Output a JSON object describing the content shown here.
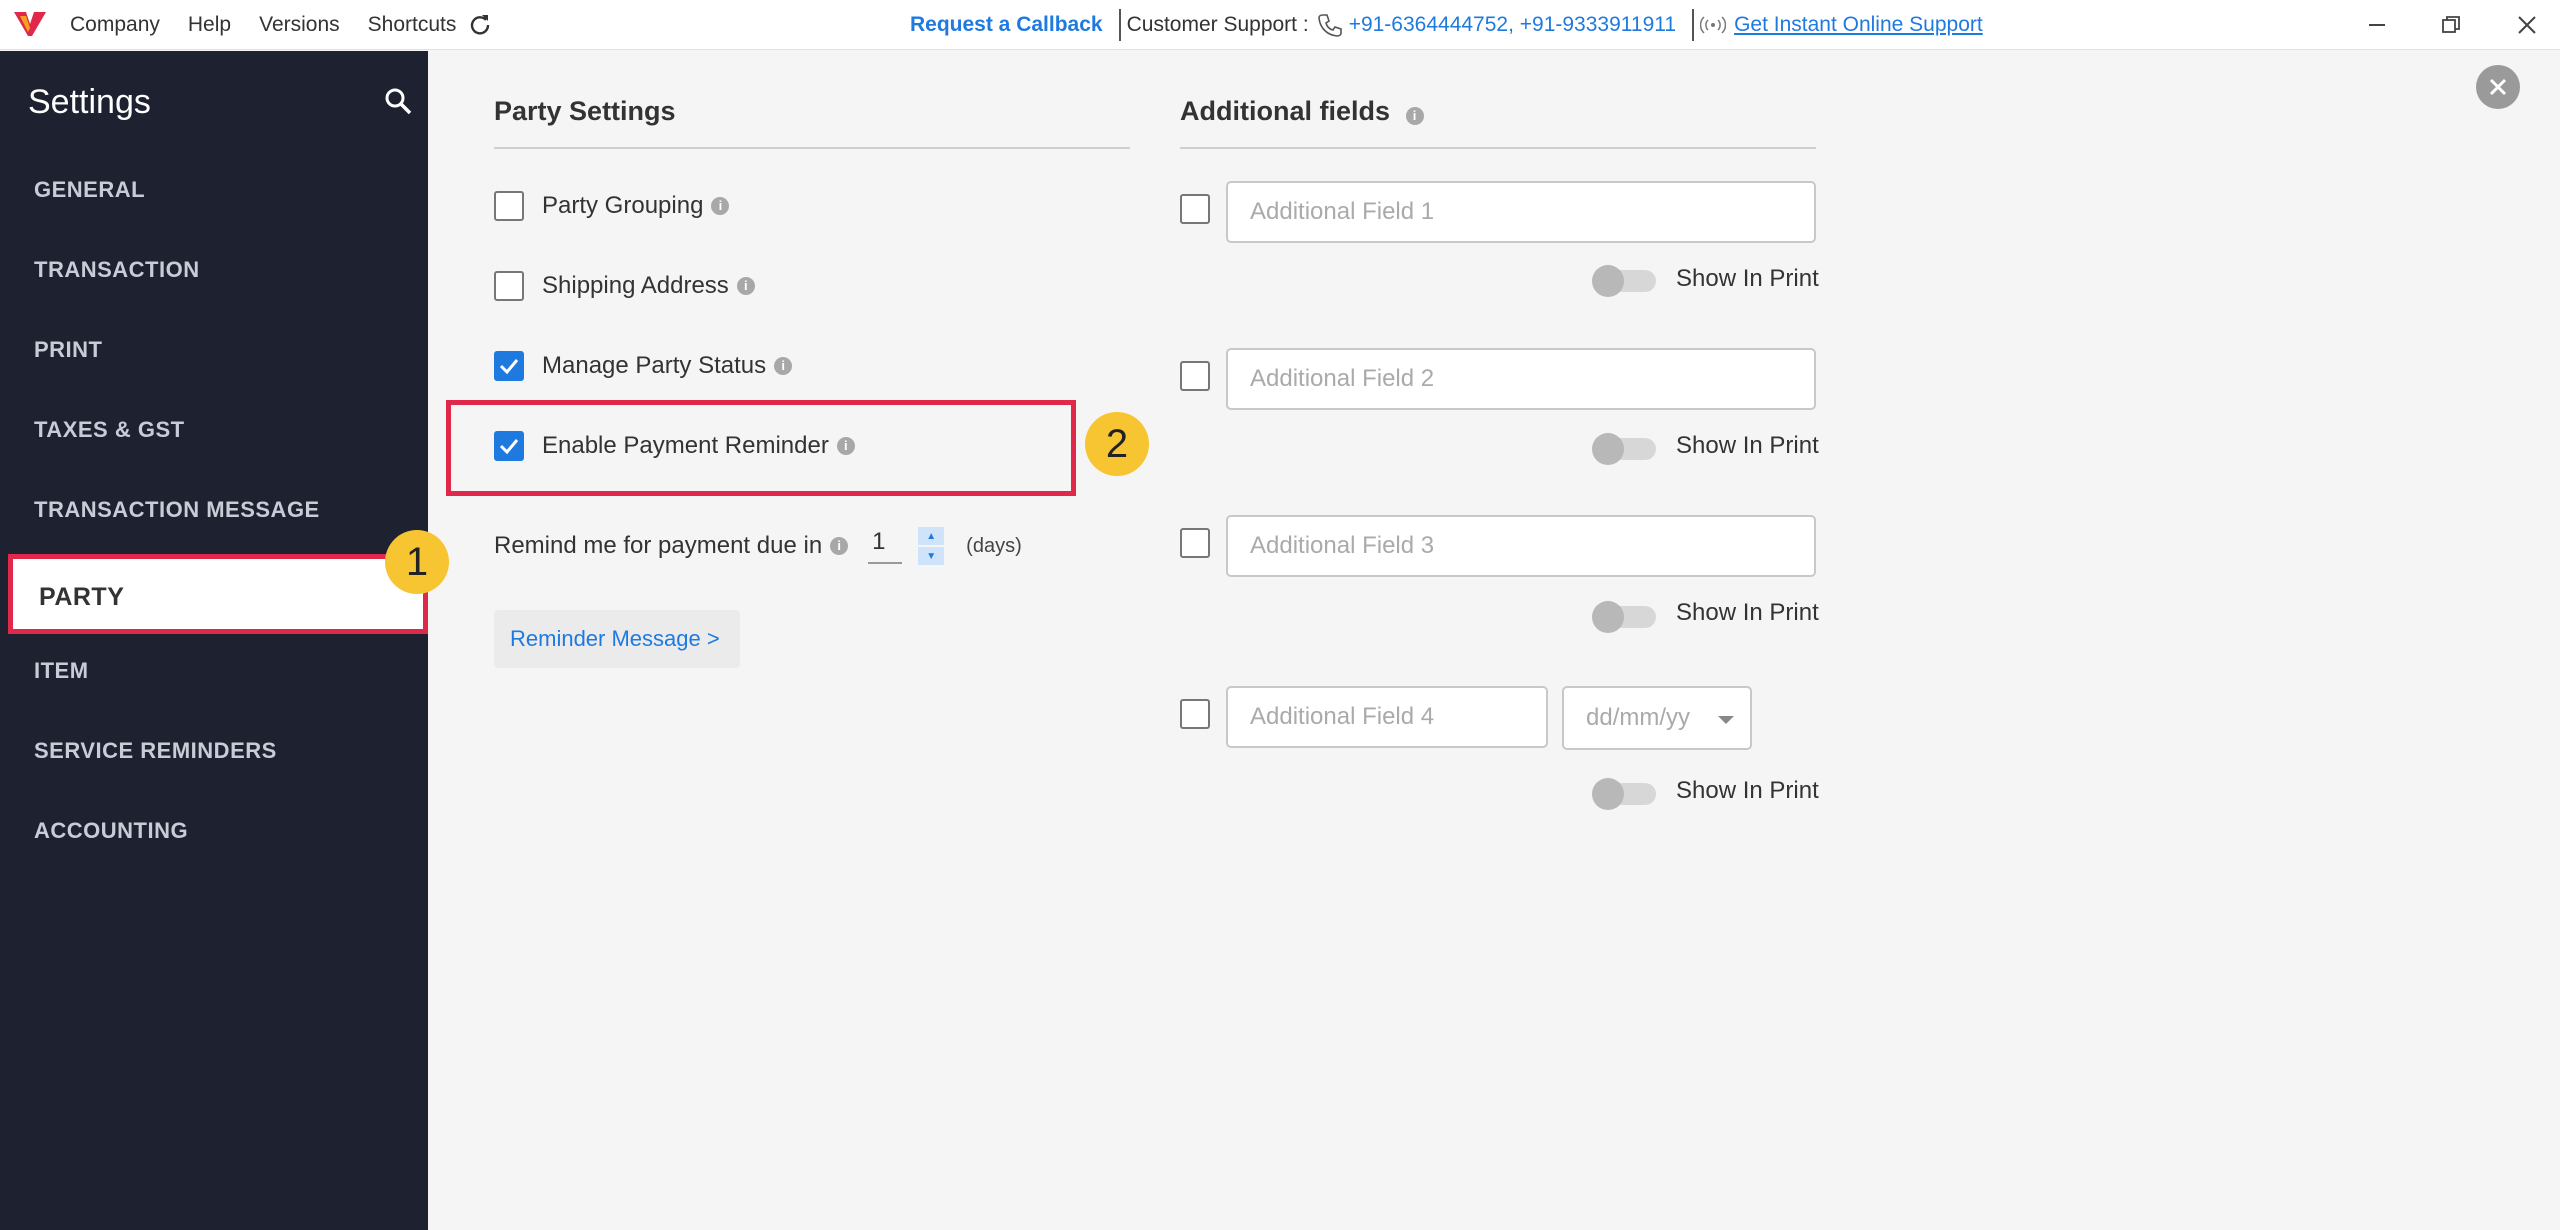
{
  "topbar": {
    "menu": [
      "Company",
      "Help",
      "Versions",
      "Shortcuts"
    ],
    "request_callback": "Request a Callback",
    "customer_support_label": "Customer Support :",
    "phones": "+91-6364444752, +91-9333911911",
    "online_support": "Get Instant Online Support"
  },
  "sidebar": {
    "title": "Settings",
    "items": [
      "GENERAL",
      "TRANSACTION",
      "PRINT",
      "TAXES & GST",
      "TRANSACTION MESSAGE",
      "PARTY",
      "ITEM",
      "SERVICE REMINDERS",
      "ACCOUNTING"
    ],
    "active_index": 5
  },
  "badges": [
    "1",
    "2"
  ],
  "party_settings": {
    "title": "Party Settings",
    "options": [
      {
        "label": "Party Grouping",
        "checked": false
      },
      {
        "label": "Shipping Address",
        "checked": false
      },
      {
        "label": "Manage Party Status",
        "checked": true
      },
      {
        "label": "Enable Payment Reminder",
        "checked": true
      }
    ],
    "remind_label": "Remind me for payment due in",
    "remind_value": "1",
    "remind_unit": "(days)",
    "reminder_button": "Reminder Message >"
  },
  "additional_fields": {
    "title": "Additional fields",
    "fields": [
      {
        "placeholder": "Additional Field 1",
        "show_in_print": "Show In Print"
      },
      {
        "placeholder": "Additional Field 2",
        "show_in_print": "Show In Print"
      },
      {
        "placeholder": "Additional Field 3",
        "show_in_print": "Show In Print"
      },
      {
        "placeholder": "Additional Field 4",
        "show_in_print": "Show In Print"
      }
    ],
    "date_format": "dd/mm/yy"
  },
  "colors": {
    "sidebar_bg": "#1e2130",
    "accent_blue": "#1f7ae0",
    "highlight_red": "#e0284a",
    "badge_yellow": "#f7c531"
  }
}
